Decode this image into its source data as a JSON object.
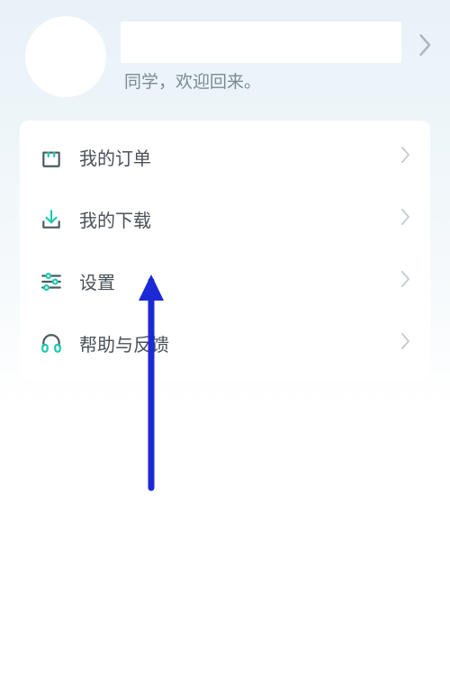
{
  "profile": {
    "welcome_text": "同学，欢迎回来。"
  },
  "menu": {
    "items": [
      {
        "icon": "bag-icon",
        "label": "我的订单"
      },
      {
        "icon": "download-icon",
        "label": "我的下载"
      },
      {
        "icon": "settings-icon",
        "label": "设置"
      },
      {
        "icon": "headset-icon",
        "label": "帮助与反馈"
      }
    ]
  }
}
